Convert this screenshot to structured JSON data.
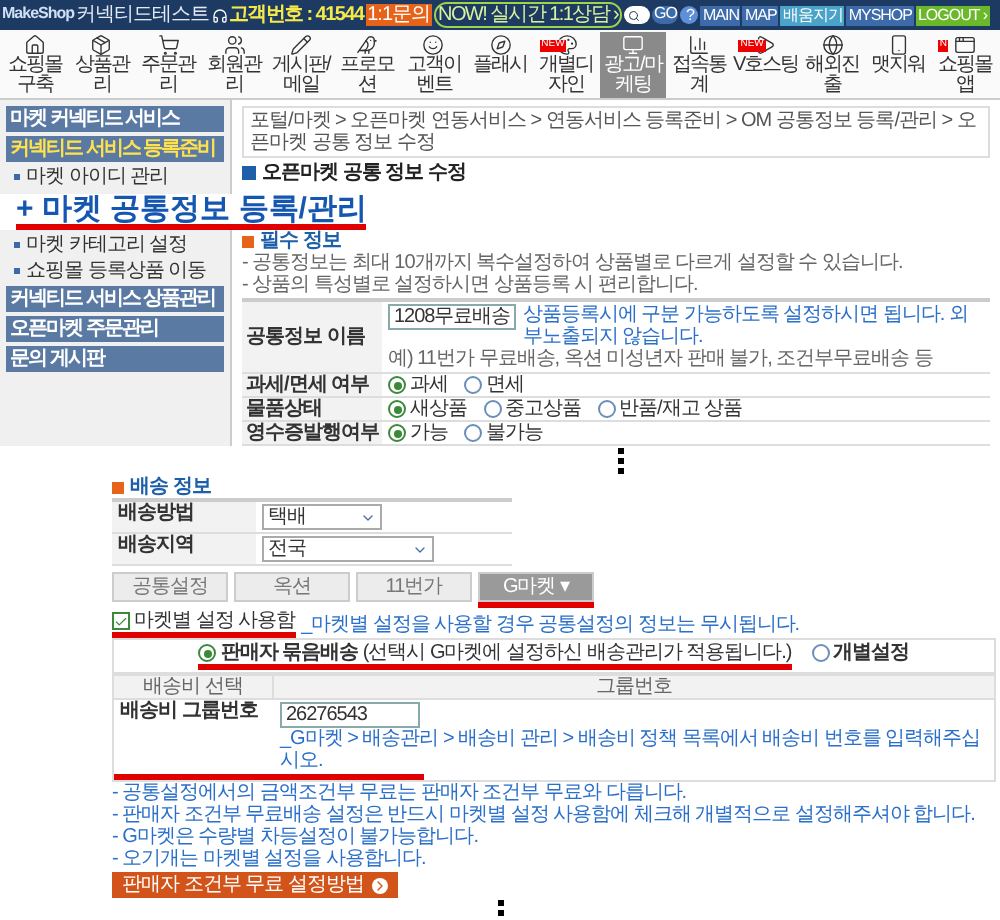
{
  "header": {
    "logo": "MakeShop",
    "shop_name": "커넥티드테스트",
    "customer_no": "고객번호 : 41544",
    "inquiry": "1:1문의",
    "live_chat": "NOW! 실시간 1:1상담 ›",
    "go": "GO",
    "help": "?",
    "links": [
      {
        "label": "MAIN",
        "color": "#3d6aa8"
      },
      {
        "label": "MAP",
        "color": "#3d6aa8"
      },
      {
        "label": "배움지기",
        "color": "#4aa3c9"
      },
      {
        "label": "MYSHOP",
        "color": "#3d6aa8"
      },
      {
        "label": "LOGOUT ›",
        "color": "#6bb82a"
      }
    ]
  },
  "toolbar": [
    {
      "label": "쇼핑몰구축",
      "selected": false
    },
    {
      "label": "상품관리",
      "selected": false
    },
    {
      "label": "주문관리",
      "selected": false
    },
    {
      "label": "회원관리",
      "selected": false
    },
    {
      "label": "게시판/메일",
      "selected": false
    },
    {
      "label": "프로모션",
      "selected": false
    },
    {
      "label": "고객이벤트",
      "selected": false
    },
    {
      "label": "플래시",
      "selected": false
    },
    {
      "label": "개별디자인",
      "badge": "NEW",
      "selected": false
    },
    {
      "label": "광고/마케팅",
      "selected": true
    },
    {
      "label": "접속통계",
      "selected": false
    },
    {
      "label": "V호스팅",
      "badge": "NEW",
      "selected": false
    },
    {
      "label": "해외진출",
      "selected": false
    },
    {
      "label": "맷지워",
      "selected": false
    },
    {
      "label": "쇼핑몰앱",
      "badge": "N",
      "selected": false
    }
  ],
  "sidebar": {
    "items": [
      {
        "label": "마켓 커넥티드 서비스",
        "selected": false
      },
      {
        "label": "커넥티드 서비스 등록준비",
        "selected": true,
        "children": [
          {
            "label": "마켓 아이디 관리"
          },
          {
            "label": "마켓 카테고리 설정"
          },
          {
            "label": "쇼핑몰 등록상품 이동"
          }
        ]
      },
      {
        "label": "커넥티드 서비스 상품관리",
        "selected": false
      },
      {
        "label": "오픈마켓 주문관리",
        "selected": false
      },
      {
        "label": "문의 게시판",
        "selected": false
      }
    ]
  },
  "callout": "+ 마켓 공통정보 등록/관리",
  "breadcrumb": "포털/마켓 > 오픈마켓 연동서비스 > 연동서비스 등록준비 > OM 공통정보 등록/관리 > 오픈마켓 공통 정보 수정",
  "title": "오픈마켓 공통 정보 수정",
  "required": {
    "heading": "필수 정보",
    "notes": [
      "- 공통정보는 최대 10개까지 복수설정하여 상품별로 다르게 설정할 수 있습니다.",
      "- 상품의 특성별로 설정하시면 상품등록 시 편리합니다."
    ],
    "name_row": {
      "label": "공통정보 이름",
      "value": "1208무료배송",
      "hint": "상품등록시에 구분 가능하도록 설정하시면 됩니다. 외부노출되지 않습니다.",
      "example": "예) 11번가 무료배송, 옥션 미성년자 판매 불가, 조건부무료배송 등"
    },
    "radio_rows": [
      {
        "label": "과세/면세 여부",
        "options": [
          {
            "label": "과세",
            "selected": true
          },
          {
            "label": "면세",
            "selected": false
          }
        ]
      },
      {
        "label": "물품상태",
        "options": [
          {
            "label": "새상품",
            "selected": true
          },
          {
            "label": "중고상품",
            "selected": false
          },
          {
            "label": "반품/재고 상품",
            "selected": false
          }
        ]
      },
      {
        "label": "영수증발행여부",
        "options": [
          {
            "label": "가능",
            "selected": true
          },
          {
            "label": "불가능",
            "selected": false
          }
        ]
      }
    ]
  },
  "shipping": {
    "heading": "배송 정보",
    "rows": [
      {
        "label": "배송방법",
        "value": "택배"
      },
      {
        "label": "배송지역",
        "value": "전국"
      }
    ],
    "tabs": [
      {
        "label": "공통설정",
        "selected": false
      },
      {
        "label": "옥션",
        "selected": false
      },
      {
        "label": "11번가",
        "selected": false
      },
      {
        "label": "G마켓 ▾",
        "selected": true
      }
    ],
    "market_setting": {
      "label": "마켓별 설정 사용함",
      "checked": true,
      "note": "_마켓별 설정을 사용할 경우 공통설정의 정보는 무시됩니다."
    },
    "modes": [
      {
        "label": "**판매자 묶음배송** (선택시 G마켓에 설정하신 배송관리가 적용됩니다.)",
        "selected": true
      },
      {
        "label": "**개별설정**",
        "selected": false
      }
    ],
    "fee_table": {
      "columns": [
        "배송비 선택",
        "그룹번호"
      ],
      "row_label": "배송비 그룹번호",
      "value": "26276543",
      "hint": "_G마켓 > 배송관리 > 배송비 관리 > 배송비 정책 목록에서 배송비 번호를 입력해주십시오."
    },
    "notes": [
      "- 공통설정에서의 금액조건부 무료는 판매자 조건부 무료와 다릅니다.",
      "- 판매자 조건부 무료배송 설정은 반드시 마켓별 설정 사용함에 체크해 개별적으로 설정해주셔야 합니다.",
      "- G마켓은 수량별 차등설정이 불가능합니다.",
      "- 오기개는 마켓별 설정을 사용합니다."
    ],
    "button": "판매자 조건부 무료 설정방법"
  }
}
